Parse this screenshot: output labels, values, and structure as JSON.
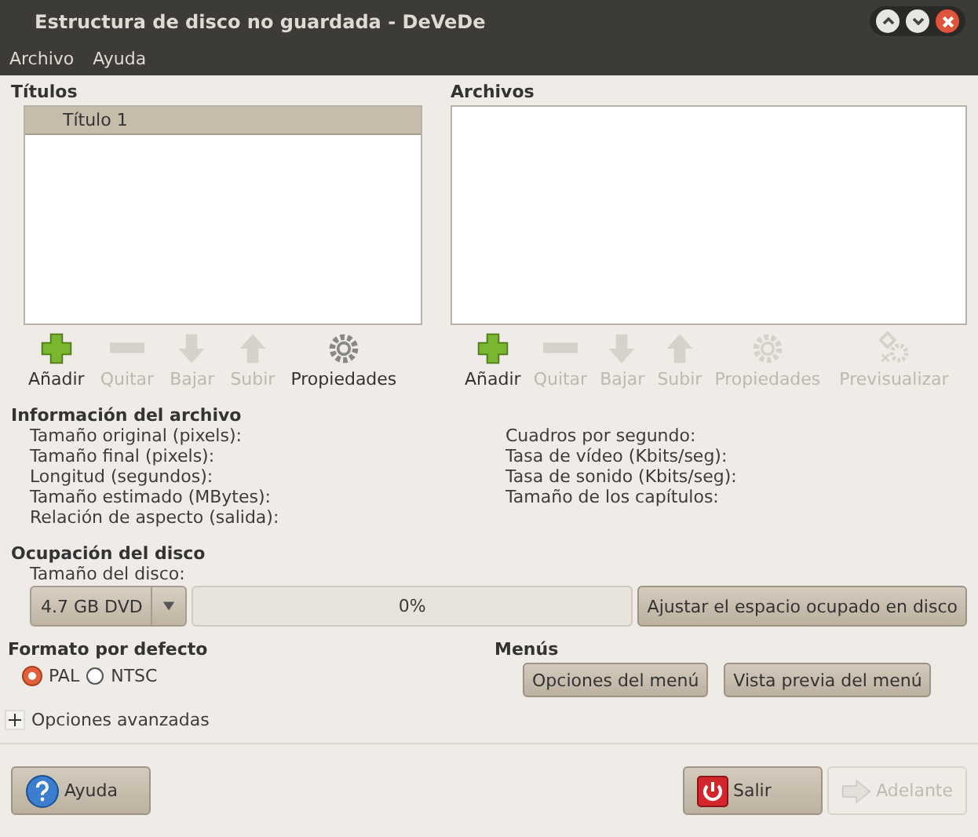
{
  "window": {
    "title": "Estructura de disco no guardada - DeVeDe"
  },
  "menu": [
    "Archivo",
    "Ayuda"
  ],
  "titles": {
    "heading": "Títulos",
    "items": [
      {
        "label": "Título 1",
        "selected": true
      }
    ],
    "tools": [
      {
        "kind": "add",
        "label": "Añadir",
        "disabled": false
      },
      {
        "kind": "remove",
        "label": "Quitar",
        "disabled": true
      },
      {
        "kind": "down",
        "label": "Bajar",
        "disabled": true
      },
      {
        "kind": "up",
        "label": "Subir",
        "disabled": true
      },
      {
        "kind": "properties",
        "label": "Propiedades",
        "disabled": false
      }
    ]
  },
  "files": {
    "heading": "Archivos",
    "tools": [
      {
        "kind": "add",
        "label": "Añadir",
        "disabled": false
      },
      {
        "kind": "remove",
        "label": "Quitar",
        "disabled": true
      },
      {
        "kind": "down",
        "label": "Bajar",
        "disabled": true
      },
      {
        "kind": "up",
        "label": "Subir",
        "disabled": true
      },
      {
        "kind": "properties",
        "label": "Propiedades",
        "disabled": true
      },
      {
        "kind": "preview",
        "label": "Previsualizar",
        "disabled": true
      }
    ]
  },
  "file_info": {
    "heading": "Información del archivo",
    "left": [
      "Tamaño original (pixels):",
      "Tamaño final (pixels):",
      "Longitud (segundos):",
      "Tamaño estimado (MBytes):",
      "Relación de aspecto (salida):"
    ],
    "right": [
      "Cuadros por segundo:",
      "Tasa de vídeo (Kbits/seg):",
      "Tasa de sonido (Kbits/seg):",
      "Tamaño de los capítulos:"
    ]
  },
  "disk": {
    "heading": "Ocupación del disco",
    "size_label": "Tamaño del disco:",
    "size_value": "4.7 GB DVD",
    "level": 0,
    "reading": "0%",
    "adjust_button": "Ajustar el espacio ocupado en disco"
  },
  "format": {
    "heading": "Formato por defecto",
    "options": [
      {
        "label": "PAL",
        "selected": true
      },
      {
        "label": "NTSC",
        "selected": false
      }
    ]
  },
  "menus": {
    "heading": "Menús",
    "buttons": [
      "Opciones del menú",
      "Vista previa del menú"
    ]
  },
  "advanced": {
    "label": "Opciones avanzadas",
    "expanded": false
  },
  "footer": {
    "help": "Ayuda",
    "quit": "Salir",
    "next": {
      "label": "Adelante",
      "disabled": true
    }
  }
}
